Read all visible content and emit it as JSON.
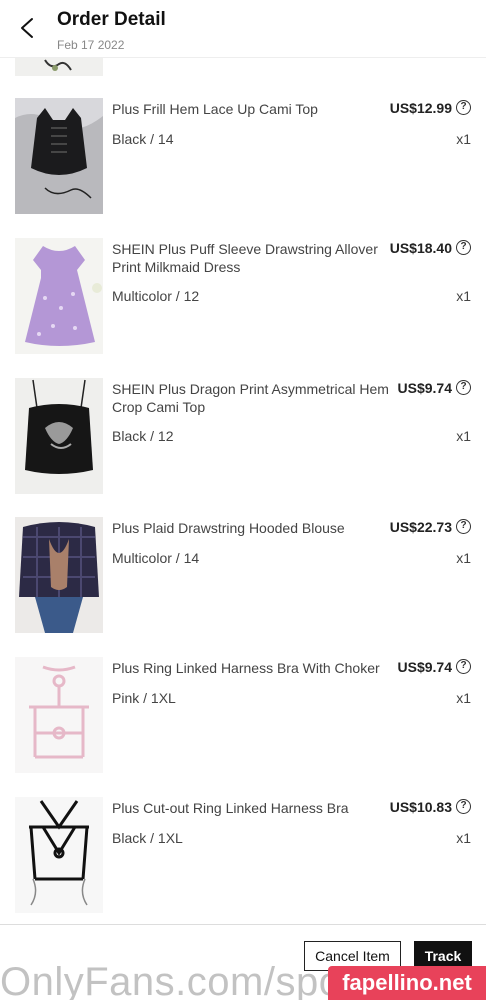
{
  "header": {
    "title": "Order Detail",
    "date": "Feb 17 2022"
  },
  "items": [
    {
      "name": "Plus Frill Hem Lace Up Cami Top",
      "price": "US$12.99",
      "variant": "Black / 14",
      "qty": "x1"
    },
    {
      "name": "SHEIN Plus Puff Sleeve Drawstring Allover Print Milkmaid Dress",
      "price": "US$18.40",
      "variant": "Multicolor / 12",
      "qty": "x1"
    },
    {
      "name": "SHEIN Plus Dragon Print Asymmetrical Hem Crop Cami Top",
      "price": "US$9.74",
      "variant": "Black / 12",
      "qty": "x1"
    },
    {
      "name": "Plus Plaid Drawstring Hooded Blouse",
      "price": "US$22.73",
      "variant": "Multicolor / 14",
      "qty": "x1"
    },
    {
      "name": "Plus Ring Linked Harness Bra With Choker",
      "price": "US$9.74",
      "variant": "Pink / 1XL",
      "qty": "x1"
    },
    {
      "name": "Plus Cut-out Ring Linked Harness Bra",
      "price": "US$10.83",
      "variant": "Black / 1XL",
      "qty": "x1"
    }
  ],
  "help_glyph": "?",
  "footer": {
    "cancel_label": "Cancel Item",
    "track_label": "Track"
  },
  "watermarks": {
    "left": "OnlyFans.com/spo",
    "right": "fapellino.net"
  }
}
